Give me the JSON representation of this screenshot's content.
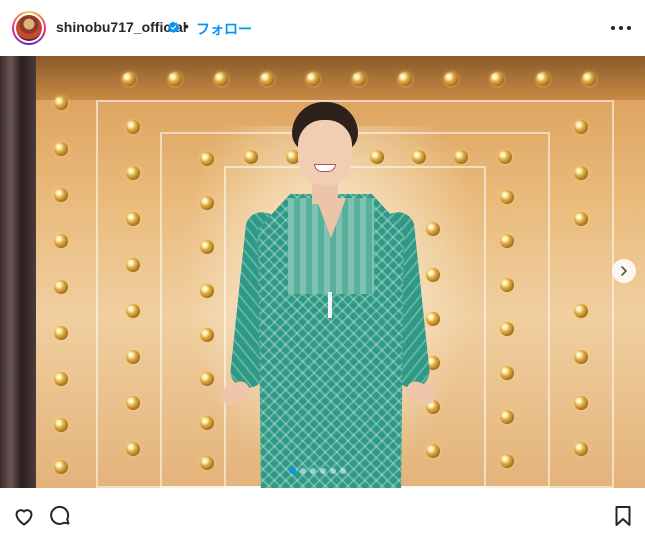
{
  "header": {
    "username": "shinobu717_official",
    "verified": true,
    "separator": "•",
    "follow_label": "フォロー",
    "more_icon": "more-horizontal-icon"
  },
  "post": {
    "image_alt": "Woman in green patterned dress standing in front of a light-bulb stage backdrop",
    "carousel_dot_count": 6,
    "active_dot_index": 0,
    "next_icon": "chevron-right-icon"
  },
  "actions": {
    "like_icon": "heart-icon",
    "comment_icon": "comment-icon",
    "save_icon": "bookmark-icon"
  },
  "colors": {
    "follow_blue": "#0095f6",
    "verified_blue": "#0095f6",
    "text": "#262626"
  }
}
